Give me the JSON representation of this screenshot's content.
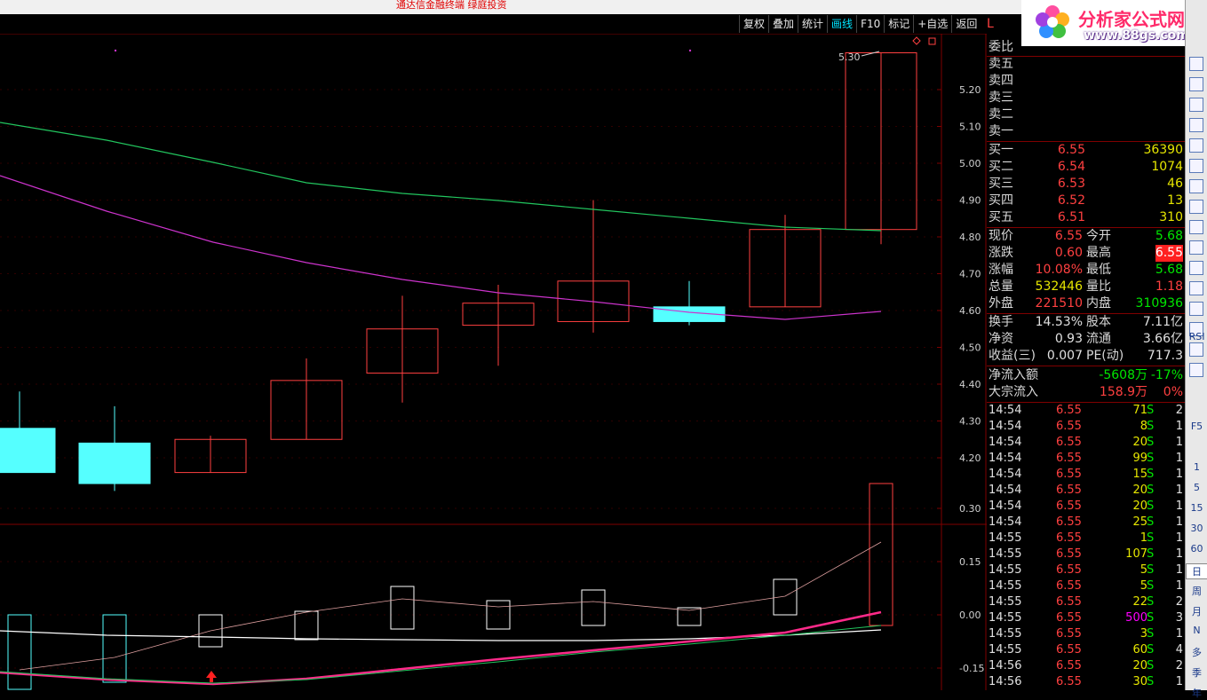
{
  "window": {
    "title": "通达信金融终端 绿庭投资"
  },
  "toolbar": [
    "复权",
    "叠加",
    "统计",
    "画线",
    "F10",
    "标记",
    "+自选",
    "返回"
  ],
  "toolbar_active": "画线",
  "panel_header": "L",
  "price_axis": [
    "5.20",
    "5.10",
    "5.00",
    "4.90",
    "4.80",
    "4.70",
    "4.60",
    "4.50",
    "4.40",
    "4.30",
    "4.20"
  ],
  "indicator_axis": [
    "0.30",
    "0.15",
    "0.00",
    "-0.15"
  ],
  "high_label": "5.30",
  "quote": {
    "weibi_label": "委比",
    "sell": [
      {
        "label": "卖五",
        "price": "",
        "vol": ""
      },
      {
        "label": "卖四",
        "price": "",
        "vol": ""
      },
      {
        "label": "卖三",
        "price": "",
        "vol": ""
      },
      {
        "label": "卖二",
        "price": "",
        "vol": ""
      },
      {
        "label": "卖一",
        "price": "",
        "vol": ""
      }
    ],
    "buy": [
      {
        "label": "买一",
        "price": "6.55",
        "vol": "36390"
      },
      {
        "label": "买二",
        "price": "6.54",
        "vol": "1074"
      },
      {
        "label": "买三",
        "price": "6.53",
        "vol": "46"
      },
      {
        "label": "买四",
        "price": "6.52",
        "vol": "13"
      },
      {
        "label": "买五",
        "price": "6.51",
        "vol": "310"
      }
    ],
    "stats": [
      {
        "l1": "现价",
        "v1": "6.55",
        "l2": "今开",
        "v2": "5.68"
      },
      {
        "l1": "涨跌",
        "v1": "0.60",
        "l2": "最高",
        "v2": "6.55"
      },
      {
        "l1": "涨幅",
        "v1": "10.08%",
        "l2": "最低",
        "v2": "5.68"
      },
      {
        "l1": "总量",
        "v1": "532446",
        "l2": "量比",
        "v2": "1.18"
      },
      {
        "l1": "外盘",
        "v1": "221510",
        "l2": "内盘",
        "v2": "310936"
      }
    ],
    "fundamentals": [
      {
        "l1": "换手",
        "v1": "14.53%",
        "l2": "股本",
        "v2": "7.11亿"
      },
      {
        "l1": "净资",
        "v1": "0.93",
        "l2": "流通",
        "v2": "3.66亿"
      },
      {
        "l1": "收益(三)",
        "v1": "0.007",
        "l2": "PE(动)",
        "v2": "717.3"
      }
    ],
    "flows": [
      {
        "label": "净流入额",
        "value": "-5608万",
        "pct": "-17%"
      },
      {
        "label": "大宗流入",
        "value": "158.9万",
        "pct": "0%"
      }
    ]
  },
  "ticks": [
    {
      "time": "14:54",
      "price": "6.55",
      "vol": "71",
      "side": "S",
      "n": "2"
    },
    {
      "time": "14:54",
      "price": "6.55",
      "vol": "8",
      "side": "S",
      "n": "1"
    },
    {
      "time": "14:54",
      "price": "6.55",
      "vol": "20",
      "side": "S",
      "n": "1"
    },
    {
      "time": "14:54",
      "price": "6.55",
      "vol": "99",
      "side": "S",
      "n": "1"
    },
    {
      "time": "14:54",
      "price": "6.55",
      "vol": "15",
      "side": "S",
      "n": "1"
    },
    {
      "time": "14:54",
      "price": "6.55",
      "vol": "20",
      "side": "S",
      "n": "1"
    },
    {
      "time": "14:54",
      "price": "6.55",
      "vol": "20",
      "side": "S",
      "n": "1"
    },
    {
      "time": "14:54",
      "price": "6.55",
      "vol": "25",
      "side": "S",
      "n": "1"
    },
    {
      "time": "14:55",
      "price": "6.55",
      "vol": "1",
      "side": "S",
      "n": "1"
    },
    {
      "time": "14:55",
      "price": "6.55",
      "vol": "107",
      "side": "S",
      "n": "1"
    },
    {
      "time": "14:55",
      "price": "6.55",
      "vol": "5",
      "side": "S",
      "n": "1"
    },
    {
      "time": "14:55",
      "price": "6.55",
      "vol": "5",
      "side": "S",
      "n": "1"
    },
    {
      "time": "14:55",
      "price": "6.55",
      "vol": "22",
      "side": "S",
      "n": "2"
    },
    {
      "time": "14:55",
      "price": "6.55",
      "vol": "500",
      "side": "S",
      "n": "3"
    },
    {
      "time": "14:55",
      "price": "6.55",
      "vol": "3",
      "side": "S",
      "n": "1"
    },
    {
      "time": "14:55",
      "price": "6.55",
      "vol": "60",
      "side": "S",
      "n": "4"
    },
    {
      "time": "14:56",
      "price": "6.55",
      "vol": "20",
      "side": "S",
      "n": "2"
    },
    {
      "time": "14:56",
      "price": "6.55",
      "vol": "30",
      "side": "S",
      "n": "1"
    }
  ],
  "sidebar_labels": [
    "RSI",
    "F5",
    "1",
    "5",
    "15",
    "30",
    "60",
    "日",
    "周",
    "月",
    "N",
    "多",
    "季",
    "年"
  ],
  "logo": {
    "main": "分析家公式网",
    "url": "www.88gs.com"
  },
  "colors": {
    "up": "#ff4040",
    "down": "#55ffff",
    "ma1": "#22c55e",
    "ma2": "#cc33cc",
    "grid": "#800000"
  },
  "candles": [
    {
      "open": 4.28,
      "high": 4.38,
      "low": 4.16,
      "close": 4.16
    },
    {
      "open": 4.24,
      "high": 4.34,
      "low": 4.11,
      "close": 4.13
    },
    {
      "open": 4.16,
      "high": 4.26,
      "low": 4.16,
      "close": 4.25
    },
    {
      "open": 4.25,
      "high": 4.47,
      "low": 4.25,
      "close": 4.41
    },
    {
      "open": 4.43,
      "high": 4.64,
      "low": 4.35,
      "close": 4.55
    },
    {
      "open": 4.56,
      "high": 4.67,
      "low": 4.45,
      "close": 4.62
    },
    {
      "open": 4.57,
      "high": 4.9,
      "low": 4.54,
      "close": 4.68
    },
    {
      "open": 4.61,
      "high": 4.68,
      "low": 4.56,
      "close": 4.57
    },
    {
      "open": 4.61,
      "high": 4.86,
      "low": 4.61,
      "close": 4.82
    },
    {
      "open": 4.82,
      "high": 5.3,
      "low": 4.78,
      "close": 5.3
    }
  ],
  "indicator_bars": [
    {
      "top": 0.0,
      "bottom": -0.21,
      "color": "#55ffff"
    },
    {
      "top": 0.0,
      "bottom": -0.19,
      "color": "#55ffff"
    },
    {
      "top": 0.0,
      "bottom": -0.09,
      "color": "#ffffff"
    },
    {
      "top": 0.01,
      "bottom": -0.07,
      "color": "#ffffff"
    },
    {
      "top": 0.08,
      "bottom": -0.04,
      "color": "#ffffff"
    },
    {
      "top": 0.04,
      "bottom": -0.04,
      "color": "#ffffff"
    },
    {
      "top": 0.07,
      "bottom": -0.03,
      "color": "#ffffff"
    },
    {
      "top": 0.02,
      "bottom": -0.03,
      "color": "#ffffff"
    },
    {
      "top": 0.1,
      "bottom": 0.0,
      "color": "#ffffff"
    },
    {
      "top": 0.37,
      "bottom": -0.03,
      "color": "#ff4040"
    }
  ]
}
